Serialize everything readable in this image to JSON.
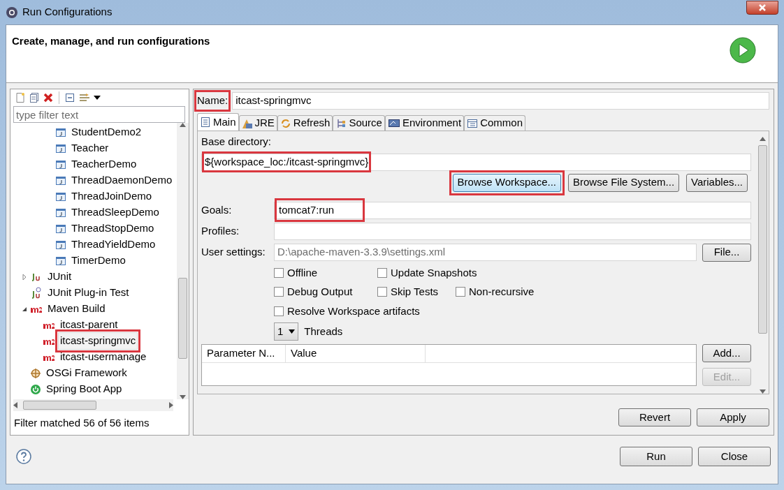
{
  "window": {
    "title": "Run Configurations"
  },
  "header": {
    "title": "Create, manage, and run configurations"
  },
  "toolbar": {
    "filter_placeholder": "type filter text"
  },
  "tree": {
    "items": [
      {
        "children": [
          {
            "label": "StudentDemo2",
            "kind": "java",
            "selected": false,
            "highlighted": false
          },
          {
            "label": "Teacher",
            "kind": "java",
            "selected": false,
            "highlighted": false
          },
          {
            "label": "TeacherDemo",
            "kind": "java",
            "selected": false,
            "highlighted": false
          },
          {
            "label": "ThreadDaemonDemo",
            "kind": "java",
            "selected": false,
            "highlighted": false
          },
          {
            "label": "ThreadJoinDemo",
            "kind": "java",
            "selected": false,
            "highlighted": false
          },
          {
            "label": "ThreadSleepDemo",
            "kind": "java",
            "selected": false,
            "highlighted": false
          },
          {
            "label": "ThreadStopDemo",
            "kind": "java",
            "selected": false,
            "highlighted": false
          },
          {
            "label": "ThreadYieldDemo",
            "kind": "java",
            "selected": false,
            "highlighted": false
          },
          {
            "label": "TimerDemo",
            "kind": "java",
            "selected": false,
            "highlighted": false
          }
        ]
      },
      {
        "label": "JUnit",
        "kind": "junit",
        "expanded": false,
        "selected": false,
        "highlighted": false
      },
      {
        "label": "JUnit Plug-in Test",
        "kind": "junit-plugin",
        "selected": false,
        "highlighted": false
      },
      {
        "label": "Maven Build",
        "kind": "maven",
        "expanded": true,
        "selected": false,
        "highlighted": false,
        "children": [
          {
            "label": "itcast-parent",
            "kind": "maven",
            "selected": false,
            "highlighted": false
          },
          {
            "label": "itcast-springmvc",
            "kind": "maven",
            "selected": true,
            "highlighted": true
          },
          {
            "label": "itcast-usermanage",
            "kind": "maven",
            "selected": false,
            "highlighted": false
          }
        ]
      },
      {
        "label": "OSGi Framework",
        "kind": "osgi",
        "selected": false,
        "highlighted": false
      },
      {
        "label": "Spring Boot App",
        "kind": "spring",
        "selected": false,
        "highlighted": false
      }
    ],
    "status": "Filter matched 56 of 56 items"
  },
  "config": {
    "name_label": "Name:",
    "name": "itcast-springmvc",
    "name_highlighted": true,
    "tabs": [
      {
        "label": "Main",
        "kind": "main",
        "selected": true
      },
      {
        "label": "JRE",
        "kind": "jre",
        "selected": false
      },
      {
        "label": "Refresh",
        "kind": "refresh",
        "selected": false
      },
      {
        "label": "Source",
        "kind": "source",
        "selected": false
      },
      {
        "label": "Environment",
        "kind": "environment",
        "selected": false
      },
      {
        "label": "Common",
        "kind": "common",
        "selected": false
      }
    ],
    "base_directory_label": "Base directory:",
    "base_directory": "${workspace_loc:/itcast-springmvc}",
    "base_directory_highlighted": true,
    "base_buttons": [
      {
        "label": "Browse Workspace...",
        "highlighted": true,
        "focused": true
      },
      {
        "label": "Browse File System...",
        "highlighted": false,
        "focused": false
      },
      {
        "label": "Variables...",
        "highlighted": false,
        "focused": false
      }
    ],
    "goals_label": "Goals:",
    "goals": "tomcat7:run",
    "goals_highlighted": true,
    "profiles_label": "Profiles:",
    "user_settings_label": "User settings:",
    "user_settings": "D:\\apache-maven-3.3.9\\settings.xml",
    "file_button": "File...",
    "checkbox_rows": [
      [
        {
          "label": "Offline",
          "checked": false
        },
        {
          "label": "Update Snapshots",
          "checked": false
        }
      ],
      [
        {
          "label": "Debug Output",
          "checked": false
        },
        {
          "label": "Skip Tests",
          "checked": false
        },
        {
          "label": "Non-recursive",
          "checked": false
        }
      ],
      [
        {
          "label": "Resolve Workspace artifacts",
          "checked": false
        }
      ]
    ],
    "threads": {
      "value": "1",
      "label": "Threads"
    },
    "parameters": {
      "columns": [
        "Parameter N...",
        "Value"
      ],
      "buttons": [
        {
          "label": "Add...",
          "disabled": false
        },
        {
          "label": "Edit...",
          "disabled": true
        }
      ]
    },
    "actions": [
      {
        "label": "Revert"
      },
      {
        "label": "Apply"
      }
    ]
  },
  "footer": {
    "buttons": [
      {
        "label": "Run"
      },
      {
        "label": "Close"
      }
    ]
  }
}
